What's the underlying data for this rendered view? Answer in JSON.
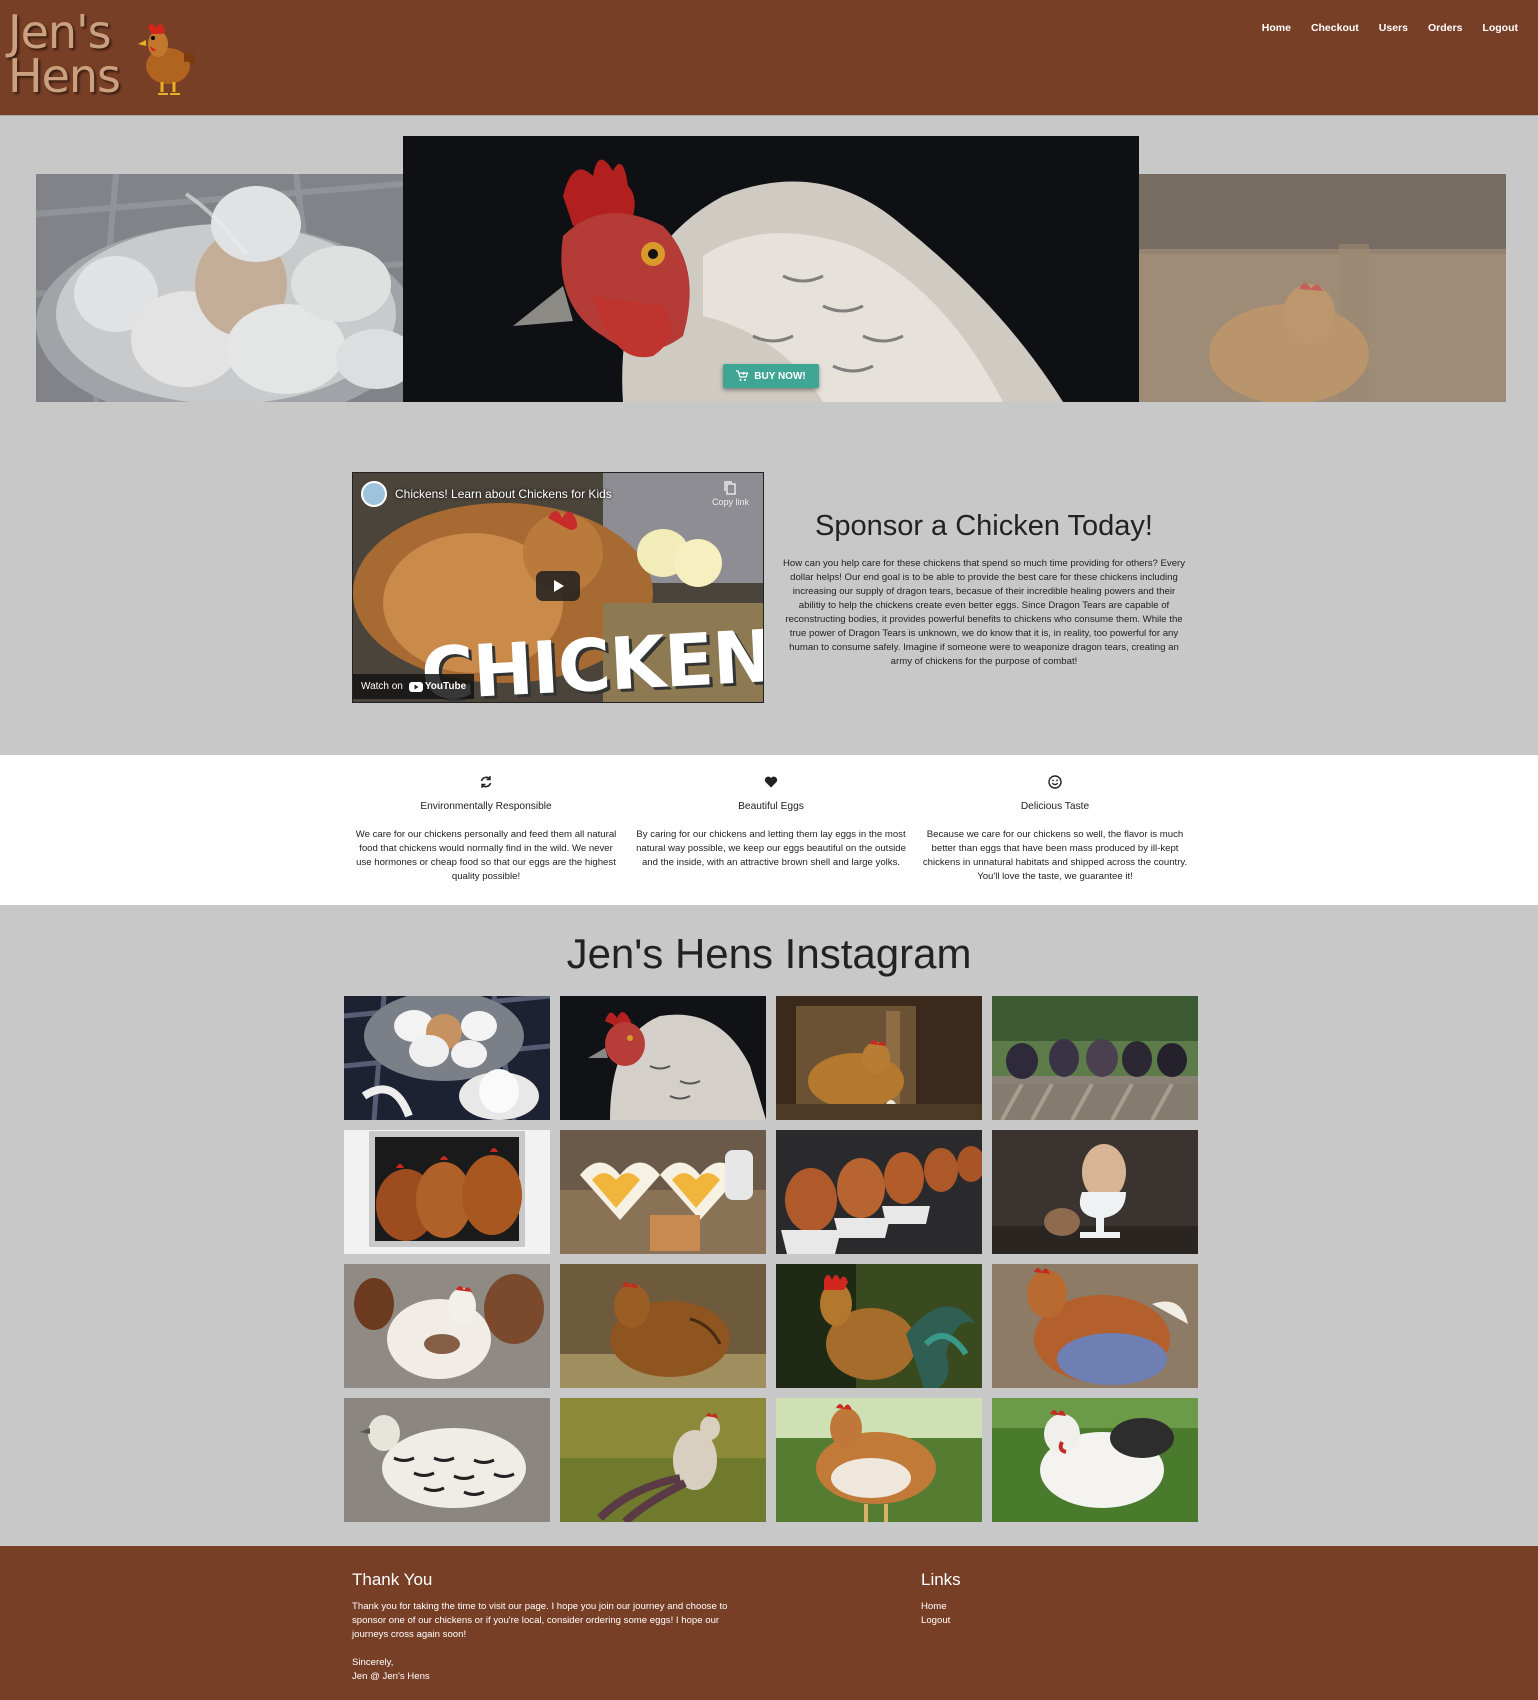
{
  "header": {
    "logo_line1": "Jen's",
    "logo_line2": "Hens",
    "nav": [
      "Home",
      "Checkout",
      "Users",
      "Orders",
      "Logout"
    ]
  },
  "carousel": {
    "buy_label": "BUY NOW!"
  },
  "video": {
    "title": "Chickens! Learn about Chickens for Kids",
    "copy_link": "Copy link",
    "big_text": "CHICKENS!",
    "watch_on": "Watch on",
    "youtube": "YouTube"
  },
  "sponsor": {
    "title": "Sponsor a Chicken Today!",
    "body": "How can you help care for these chickens that spend so much time providing for others? Every dollar helps! Our end goal is to be able to provide the best care for these chickens including increasing our supply of dragon tears, becasue of their incredible healing powers and their abilitiy to help the chickens create even better eggs. Since Dragon Tears are capable of reconstructing bodies, it provides powerful benefits to chickens who consume them. While the true power of Dragon Tears is unknown, we do know that it is, in reality, too powerful for any human to consume safely. Imagine if someone were to weaponize dragon tears, creating an army of chickens for the purpose of combat!"
  },
  "features": [
    {
      "icon": "refresh-icon",
      "title": "Environmentally Responsible",
      "body": "We care for our chickens personally and feed them all natural food that chickens would normally find in the wild. We never use hormones or cheap food so that our eggs are the highest quality possible!"
    },
    {
      "icon": "heart-icon",
      "title": "Beautiful Eggs",
      "body": "By caring for our chickens and letting them lay eggs in the most natural way possible, we keep our eggs beautiful on the outside and the inside, with an attractive brown shell and large yolks."
    },
    {
      "icon": "smile-icon",
      "title": "Delicious Taste",
      "body": "Because we care for our chickens so well, the flavor is much better than eggs that have been mass produced by ill-kept chickens in unnatural habitats and shipped across the country. You'll love the taste, we guarantee it!"
    }
  ],
  "instagram": {
    "title": "Jen's Hens Instagram"
  },
  "footer": {
    "thanks_title": "Thank You",
    "thanks_body": "Thank you for taking the time to visit our page. I hope you join our journey and choose to sponsor one of our chickens or if you're local, consider ordering some eggs! I hope our journeys cross again soon!",
    "signoff1": "Sincerely,",
    "signoff2": "Jen @ Jen's Hens",
    "links_title": "Links",
    "links": [
      "Home",
      "Logout"
    ]
  }
}
